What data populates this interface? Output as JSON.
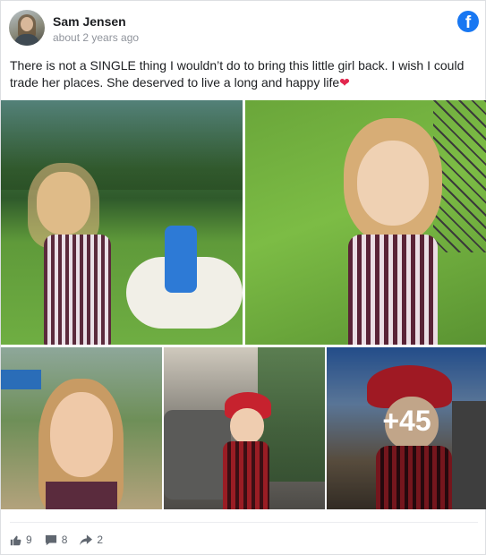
{
  "post": {
    "author": "Sam Jensen",
    "timestamp": "about 2 years ago",
    "text": "There is not a SINGLE thing I wouldn’t do to bring this little girl back. I wish I could trade her places. She deserved to live a long and happy life",
    "text_emoji": "❤",
    "source_icon": "facebook-icon",
    "colors": {
      "brand": "#1877f2",
      "muted": "#90949c",
      "heart": "#e2264d"
    }
  },
  "photos": {
    "more_count": "+45"
  },
  "stats": {
    "likes": "9",
    "comments": "8",
    "shares": "2",
    "icons": [
      "thumbs-up-icon",
      "comment-icon",
      "share-icon"
    ]
  }
}
